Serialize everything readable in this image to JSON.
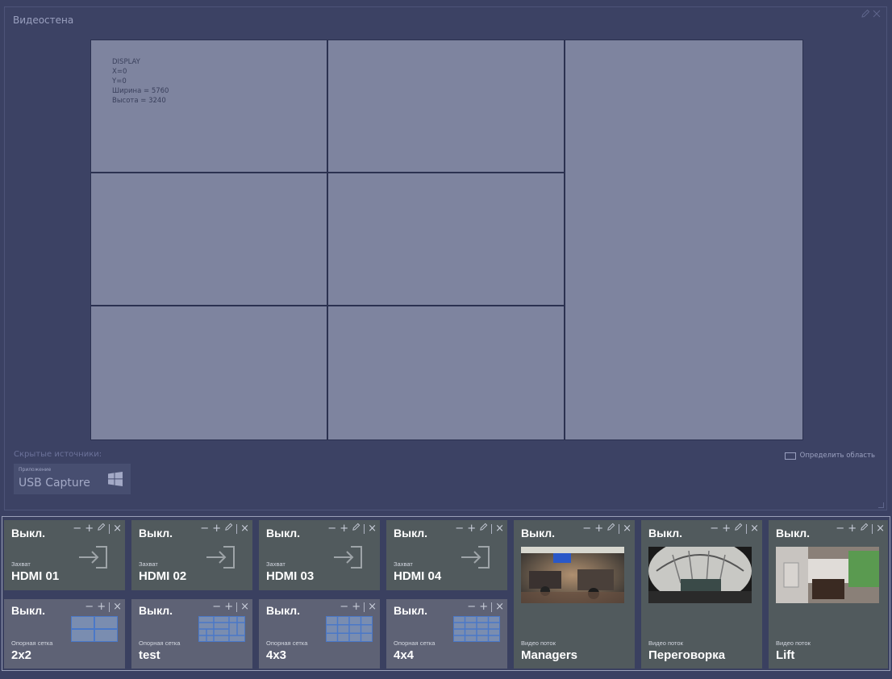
{
  "panel": {
    "title": "Видеостена",
    "hidden_sources_label": "Скрытые источники:",
    "usb_source": {
      "type_label": "Приложение",
      "name": "USB Capture",
      "icon": "windows-icon"
    },
    "define_area_label": "Определить область",
    "icons": [
      "edit-icon",
      "close-icon"
    ]
  },
  "wall": {
    "display_info": "DISPLAY\nX=0\nY=0\nШирина = 5760\nВысота = 3240"
  },
  "tiles": {
    "capture": [
      {
        "state": "Выкл.",
        "type_label": "Захват",
        "name": "HDMI 01",
        "icon": "input-arrow-icon"
      },
      {
        "state": "Выкл.",
        "type_label": "Захват",
        "name": "HDMI 02",
        "icon": "input-arrow-icon"
      },
      {
        "state": "Выкл.",
        "type_label": "Захват",
        "name": "HDMI 03",
        "icon": "input-arrow-icon"
      },
      {
        "state": "Выкл.",
        "type_label": "Захват",
        "name": "HDMI 04",
        "icon": "input-arrow-icon"
      }
    ],
    "grids": [
      {
        "state": "Выкл.",
        "type_label": "Опорная сетка",
        "name": "2x2",
        "icon": "grid-layout-icon"
      },
      {
        "state": "Выкл.",
        "type_label": "Опорная сетка",
        "name": "test",
        "icon": "grid-layout-icon"
      },
      {
        "state": "Выкл.",
        "type_label": "Опорная сетка",
        "name": "4x3",
        "icon": "grid-layout-icon"
      },
      {
        "state": "Выкл.",
        "type_label": "Опорная сетка",
        "name": "4x4",
        "icon": "grid-layout-icon"
      }
    ],
    "streams": [
      {
        "state": "Выкл.",
        "type_label": "Видео поток",
        "name": "Managers",
        "icon": "camera-preview"
      },
      {
        "state": "Выкл.",
        "type_label": "Видео поток",
        "name": "Переговорка",
        "icon": "camera-preview"
      },
      {
        "state": "Выкл.",
        "type_label": "Видео поток",
        "name": "Lift",
        "icon": "camera-preview"
      }
    ]
  },
  "colors": {
    "background": "#3b4163",
    "wall_cell": "#7e849f",
    "source_tile": "#515a5d",
    "grid_tile": "#5e6275",
    "grid_icon": "#4a78c8"
  }
}
